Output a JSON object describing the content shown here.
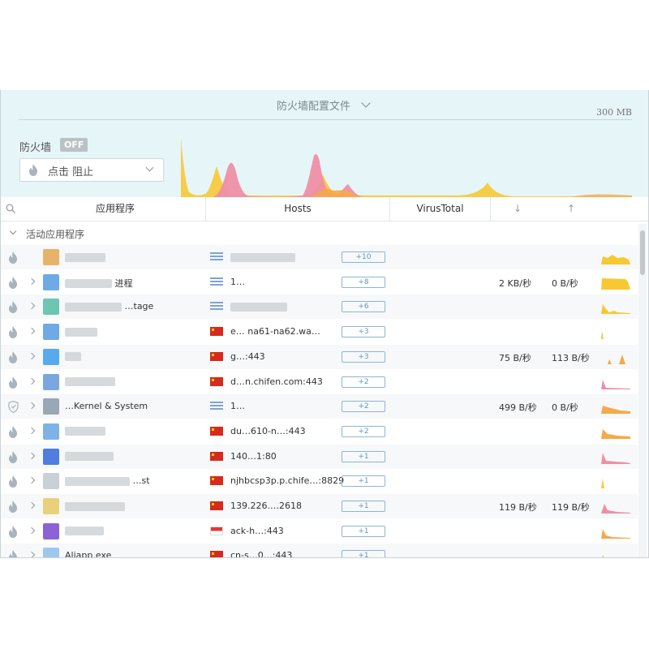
{
  "header": {
    "profile_label": "防火墙配置文件",
    "memory": "300 MB",
    "firewall_label": "防火墙",
    "firewall_state": "OFF",
    "block_dropdown_label": "点击 阻止"
  },
  "columns": {
    "app": "应用程序",
    "hosts": "Hosts",
    "virustotal": "VirusTotal",
    "down_symbol": "↓",
    "up_symbol": "↑"
  },
  "section": {
    "label": "活动应用程序"
  },
  "colors": {
    "chart_yellow": "#f8c833",
    "chart_pink": "#ee8fa8",
    "chart_orange": "#f6a94a",
    "header_bg": "#e6f5f8",
    "badge_border": "#8fb4d6"
  },
  "rows": [
    {
      "status_icon": "flame-icon",
      "app_name": "",
      "host": "",
      "host_icon": "lan-icon",
      "count": "+10",
      "down": "",
      "up": "",
      "spark_color": "#f8c833"
    },
    {
      "status_icon": "flame-icon",
      "app_name": "进程",
      "host": "1…",
      "host_icon": "lan-icon",
      "count": "+8",
      "down": "2 KB/秒",
      "up": "0 B/秒",
      "spark_color": "#f8c833"
    },
    {
      "status_icon": "flame-icon",
      "app_name": "…tage",
      "host": "",
      "host_icon": "lan-icon",
      "count": "+6",
      "down": "",
      "up": "",
      "spark_color": "#f8c833"
    },
    {
      "status_icon": "flame-icon",
      "app_name": "",
      "host": "e… na61-na62.wa…",
      "host_icon": "flag-cn-icon",
      "count": "+3",
      "down": "",
      "up": "",
      "spark_color": "#f8c833"
    },
    {
      "status_icon": "flame-icon",
      "app_name": "",
      "host": "g…:443",
      "host_icon": "flag-cn-icon",
      "count": "+3",
      "down": "75 B/秒",
      "up": "113 B/秒",
      "spark_color": "#f6a94a"
    },
    {
      "status_icon": "flame-icon",
      "app_name": "",
      "host": "d…n.chifen.com:443",
      "host_icon": "flag-cn-icon",
      "count": "+2",
      "down": "",
      "up": "",
      "spark_color": "#ee8fa8"
    },
    {
      "status_icon": "shield-icon",
      "app_name": "…Kernel & System",
      "host": "1…",
      "host_icon": "lan-icon",
      "count": "+2",
      "down": "499 B/秒",
      "up": "0 B/秒",
      "spark_color": "#f6a94a"
    },
    {
      "status_icon": "flame-icon",
      "app_name": "",
      "host": "du…610-n…:443",
      "host_icon": "flag-cn-icon",
      "count": "+2",
      "down": "",
      "up": "",
      "spark_color": "#f6a94a"
    },
    {
      "status_icon": "flame-icon",
      "app_name": "",
      "host": "140…1:80",
      "host_icon": "flag-cn-icon",
      "count": "+1",
      "down": "",
      "up": "",
      "spark_color": "#ee8fa8"
    },
    {
      "status_icon": "flame-icon",
      "app_name": "…st",
      "host": "njhbcsp3p.p.chife…:8829",
      "host_icon": "flag-cn-icon",
      "count": "+1",
      "down": "",
      "up": "",
      "spark_color": "#f8c833"
    },
    {
      "status_icon": "flame-icon",
      "app_name": "",
      "host": "139.226.…2618",
      "host_icon": "flag-cn-icon",
      "count": "+1",
      "down": "119 B/秒",
      "up": "119 B/秒",
      "spark_color": "#ee8fa8"
    },
    {
      "status_icon": "flame-icon",
      "app_name": "",
      "host": "ack-h…:443",
      "host_icon": "flag-sg-icon",
      "count": "+1",
      "down": "",
      "up": "",
      "spark_color": "#f6a94a"
    },
    {
      "status_icon": "flame-icon",
      "app_name": "Aliapp.exe",
      "host": "cn-s…0…:443",
      "host_icon": "flag-cn-icon",
      "count": "+1",
      "down": "",
      "up": "",
      "spark_color": "#f8c833"
    }
  ]
}
